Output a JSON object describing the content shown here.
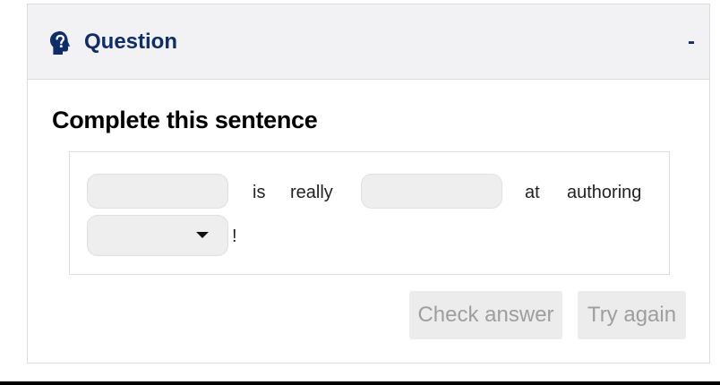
{
  "header": {
    "title": "Question",
    "collapse_label": "-",
    "icon": "question-head-icon"
  },
  "prompt": "Complete this sentence",
  "sentence": {
    "blank1_value": "",
    "word_is": "is",
    "word_really": "really",
    "blank2_value": "",
    "word_at": "at",
    "word_authoring": "authoring",
    "dropdown_value": "",
    "word_exclamation": "!"
  },
  "buttons": {
    "check_answer": "Check answer",
    "try_again": "Try again"
  },
  "colors": {
    "header_text": "#0d2d6b",
    "header_bg": "#f2f2f4",
    "blank_bg": "#eeeeee",
    "button_disabled_text": "#9e9e9e"
  }
}
